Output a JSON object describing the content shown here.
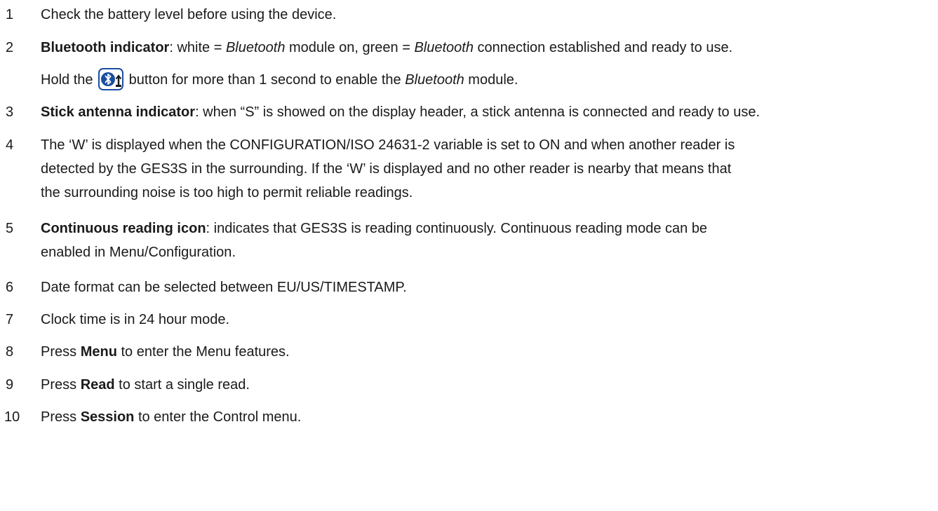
{
  "items": [
    {
      "num": "1",
      "text": "Check the battery level before using the device."
    },
    {
      "num": "2",
      "bold": "Bluetooth indicator",
      "p1": ": white = ",
      "it1": "Bluetooth",
      "p2": " module on, green = ",
      "it2": "Bluetooth",
      "p3": " connection established and ready to use.",
      "hold_a": "Hold the ",
      "hold_b": " button for more than 1 second to enable the ",
      "hold_it": "Bluetooth",
      "hold_c": " module."
    },
    {
      "num": "3",
      "bold": "Stick antenna indicator",
      "rest": ": when “S” is showed on the display header, a stick antenna is connected and ready to use."
    },
    {
      "num": "4",
      "l1": "The ‘W’ is displayed when the CONFIGURATION/ISO 24631-2 variable is set to ON and when another reader is",
      "l2": "detected by the GES3S in the surrounding. If the ‘W’ is displayed and no other reader is nearby that means that",
      "l3": "the surrounding noise is too high to permit reliable readings."
    },
    {
      "num": "5",
      "bold": "Continuous reading icon",
      "l1": ": indicates that GES3S is reading continuously. Continuous reading mode can be",
      "l2a": "enabled in ",
      "l2b": "Menu/Configuration",
      "l2c": "."
    },
    {
      "num": "6",
      "text": "Date format can be selected between EU/US/TIMESTAMP."
    },
    {
      "num": "7",
      "text": "Clock time is in 24 hour mode."
    },
    {
      "num": "8",
      "a": "Press ",
      "bold": "Menu",
      "b": " to enter the Menu features."
    },
    {
      "num": "9",
      "a": "Press ",
      "bold": "Read",
      "b": " to start a single read."
    },
    {
      "num": "10",
      "a": "Press ",
      "bold": "Session",
      "b": " to enter the Control menu."
    }
  ],
  "icons": {
    "bluetooth_button": "bluetooth-power-button-icon"
  },
  "colors": {
    "text": "#1a1a1a",
    "icon_border": "#1a4fa0",
    "icon_fill": "#1a4fa0"
  }
}
